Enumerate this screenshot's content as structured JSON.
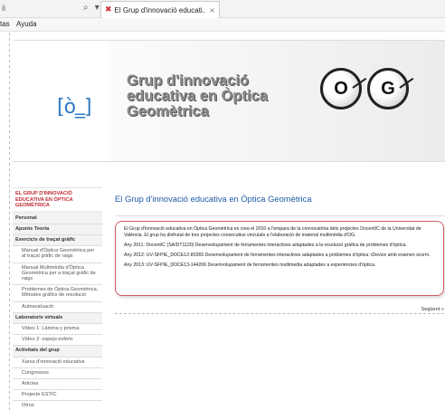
{
  "browser": {
    "url_fragment": "il",
    "nav_icons": "⌕ ▾ ≣ ↻",
    "tab": {
      "icon": "✖",
      "title": "El Grup d'innovació educati...",
      "close": "×"
    },
    "menu": [
      "tas",
      "Ayuda"
    ]
  },
  "banner": {
    "logo_text": "[ò‗]",
    "title_lines": [
      "Grup d'innovació",
      "educativa en Òptica",
      "Geomètrica"
    ],
    "eyes": [
      "O",
      "G"
    ]
  },
  "sidebar": {
    "header": "EL GRUP D'INNOVACIÓ EDUCATIVA EN ÒPTICA GEOMÈTRICA",
    "items": [
      {
        "label": "Personal",
        "type": "group"
      },
      {
        "label": "Apunts Teoria",
        "type": "group"
      },
      {
        "label": "Exercicis de traçat gràfic",
        "type": "group"
      },
      {
        "label": "Manual d'Òptica Geomètrica per al traçat gràfic de raigs",
        "type": "sub"
      },
      {
        "label": "Manual Multimèdia d'Òptica Geomètrica per a traçat gràfic de raigs",
        "type": "sub"
      },
      {
        "label": "Problemes de Òptica Geomètrica. Mètodes gràfics de resolució",
        "type": "sub"
      },
      {
        "label": "Autoavaluació",
        "type": "sub"
      },
      {
        "label": "Laboratoris virtuals",
        "type": "group"
      },
      {
        "label": "Vídeo 1: Làmina y prisma",
        "type": "sub"
      },
      {
        "label": "Vídeo 2: espejo esfèric",
        "type": "sub"
      },
      {
        "label": "Activitats del grup",
        "type": "group"
      },
      {
        "label": "Xarxa d'innovació educativa",
        "type": "sub"
      },
      {
        "label": "Congressos",
        "type": "sub"
      },
      {
        "label": "Articles",
        "type": "sub"
      },
      {
        "label": "Projecte ESTIC",
        "type": "sub"
      },
      {
        "label": "Otros",
        "type": "sub"
      }
    ]
  },
  "main": {
    "title": "El Grup d'innovació educativa en Òptica Geomètrica",
    "paragraphs": [
      "El Grup d'innovació educativa en Òptica Geomètrica es crea el 2010 a l'empara de la convocatòria dels projectes DocentIC de la Universitat de València. El grup ha disfrutat de tres projectes consecutius vinculats a l'elaboració de material multimèdia d'OG.",
      "Any 2011: DocentIC (SA/DT1120) Desenvolupament de ferramentes interactives adaptades a la resolució gràfica de problemes d'òptica.",
      "Any 2012: UV-SFPIE_DOCE12-80365 Desenvolupament de ferramentes interactives adaptades a problemes d'òptica: iDevice amb examen scorm.",
      "Any 2013: UV-SFPIE_DOCE13-144206 Desenvolupament de ferramentes multimedia adaptades a experiències d'òptica."
    ],
    "next_link": "Següent »"
  }
}
